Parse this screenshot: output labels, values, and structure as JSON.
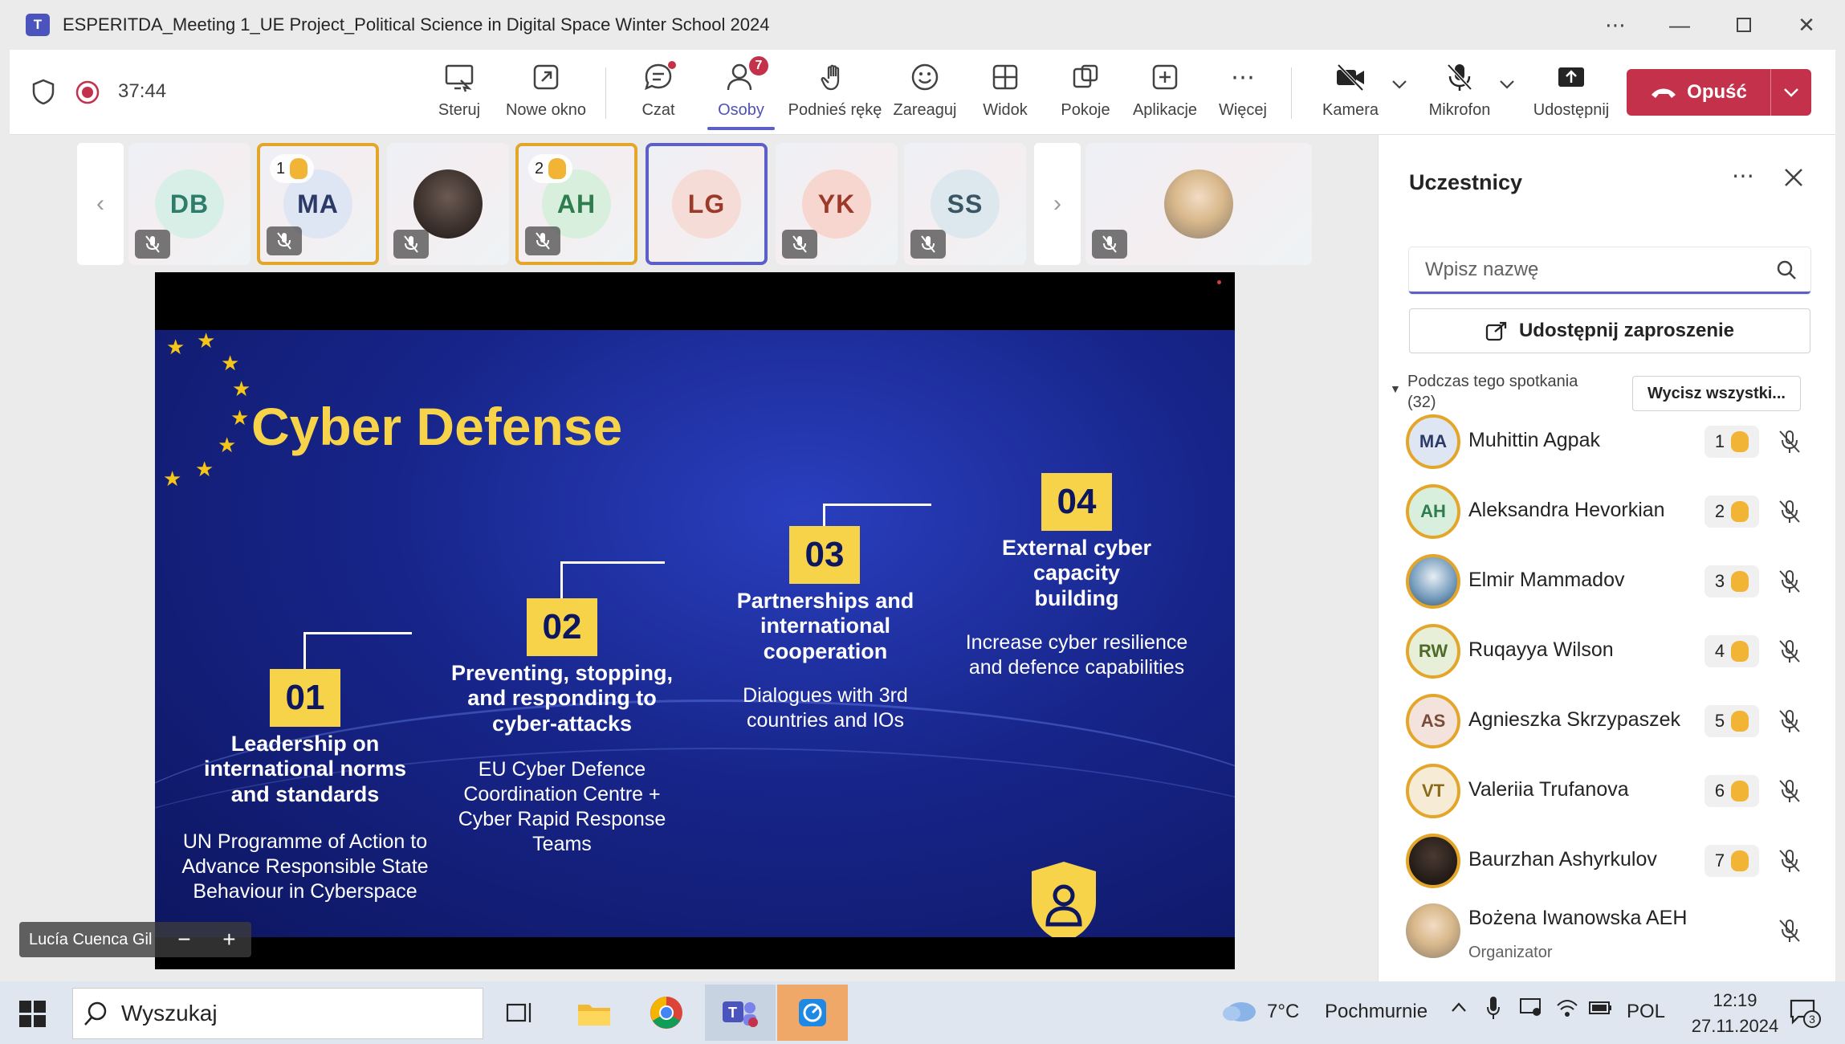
{
  "window": {
    "title": "ESPERITDA_Meeting 1_UE Project_Political Science in Digital Space Winter School 2024",
    "app_icon_letter": "T"
  },
  "toolbar": {
    "timer": "37:44",
    "items": [
      {
        "label": "Steruj",
        "icon": "share-screen-icon"
      },
      {
        "label": "Nowe okno",
        "icon": "new-window-icon"
      },
      {
        "label": "Czat",
        "icon": "chat-icon"
      },
      {
        "label": "Osoby",
        "icon": "people-icon",
        "badge": "7"
      },
      {
        "label": "Podnieś rękę",
        "icon": "raise-hand-icon"
      },
      {
        "label": "Zareaguj",
        "icon": "smiley-icon"
      },
      {
        "label": "Widok",
        "icon": "grid-view-icon"
      },
      {
        "label": "Pokoje",
        "icon": "rooms-icon"
      },
      {
        "label": "Aplikacje",
        "icon": "apps-icon"
      },
      {
        "label": "Więcej",
        "icon": "more-icon"
      },
      {
        "label": "Kamera",
        "icon": "camera-off-icon"
      },
      {
        "label": "Mikrofon",
        "icon": "mic-off-icon"
      },
      {
        "label": "Udostępnij",
        "icon": "share-icon"
      }
    ],
    "leave_label": "Opuść",
    "leave_color": "#c4314b"
  },
  "strip": {
    "tiles": [
      {
        "initials": "DB",
        "color": "#2e7d6b",
        "bg": "#d7efe7"
      },
      {
        "initials": "MA",
        "color": "#2b3a67",
        "bg": "#dfe6f3",
        "hand": "1"
      },
      {
        "initials": "",
        "photo": true
      },
      {
        "initials": "AH",
        "color": "#2e7d4f",
        "bg": "#d9efdd",
        "hand": "2"
      },
      {
        "initials": "LG",
        "color": "#9c3a2a",
        "bg": "#f6dcd6"
      },
      {
        "initials": "YK",
        "color": "#9c3a2a",
        "bg": "#f6d6cf"
      },
      {
        "initials": "SS",
        "color": "#3a5563",
        "bg": "#dde8ee"
      }
    ]
  },
  "slide": {
    "title": "Cyber Defense",
    "steps": [
      {
        "num": "01",
        "heading": [
          "Leadership on",
          "international norms",
          "and standards"
        ],
        "body": [
          "UN Programme of Action to",
          "Advance Responsible State",
          "Behaviour in Cyberspace"
        ]
      },
      {
        "num": "02",
        "heading": [
          "Preventing, stopping,",
          "and responding to",
          "cyber-attacks"
        ],
        "body": [
          "EU Cyber Defence",
          "Coordination Centre +",
          "Cyber Rapid Response",
          "Teams"
        ]
      },
      {
        "num": "03",
        "heading": [
          "Partnerships and",
          "international",
          "cooperation"
        ],
        "body": [
          "Dialogues with 3rd",
          "countries and IOs"
        ]
      },
      {
        "num": "04",
        "heading": [
          "External cyber",
          "capacity",
          "building"
        ],
        "body": [
          "Increase cyber resilience",
          "and defence capabilities"
        ]
      }
    ],
    "accent": "#f7d34a"
  },
  "nametag": {
    "name": "Lucía Cuenca Gil"
  },
  "panel": {
    "title": "Uczestnicy",
    "search_placeholder": "Wpisz nazwę",
    "invite_label": "Udostępnij zaproszenie",
    "section_label": "Podczas tego spotkania (32)",
    "mute_all_label": "Wycisz wszystki...",
    "participants": [
      {
        "initials": "MA",
        "name": "Muhittin Agpak",
        "hand": "1",
        "bg": "#dfe6f3",
        "fg": "#2b3a67"
      },
      {
        "initials": "AH",
        "name": "Aleksandra Hevorkian",
        "hand": "2",
        "bg": "#d9efdd",
        "fg": "#2e7d4f"
      },
      {
        "initials": "",
        "name": "Elmir Mammadov",
        "hand": "3",
        "photo": true
      },
      {
        "initials": "RW",
        "name": "Ruqayya Wilson",
        "hand": "4",
        "bg": "#e7efd9",
        "fg": "#4e6b2a"
      },
      {
        "initials": "AS",
        "name": "Agnieszka Skrzypaszek",
        "hand": "5",
        "bg": "#f3e3dc",
        "fg": "#7a4a3a"
      },
      {
        "initials": "VT",
        "name": "Valeriia Trufanova",
        "hand": "6",
        "bg": "#f6ecd5",
        "fg": "#8a6a1a"
      },
      {
        "initials": "",
        "name": "Baurzhan Ashyrkulov",
        "hand": "7",
        "photo": true
      },
      {
        "initials": "",
        "name": "Bożena Iwanowska AEH",
        "role": "Organizator",
        "photo": true
      }
    ]
  },
  "taskbar": {
    "search_placeholder": "Wyszukaj",
    "weather_temp": "7°C",
    "weather_text": "Pochmurnie",
    "lang": "POL",
    "time": "12:19",
    "date": "27.11.2024",
    "notif_count": "3"
  }
}
